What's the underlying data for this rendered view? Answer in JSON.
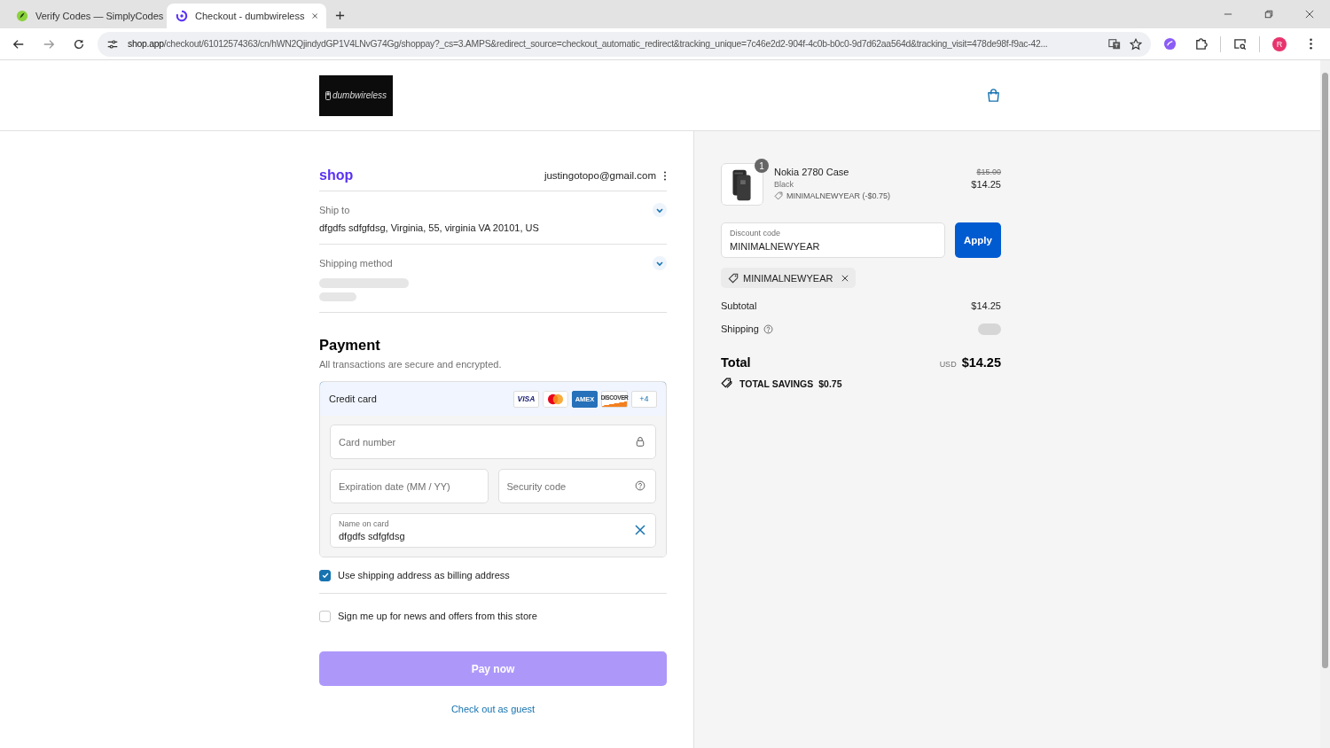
{
  "browser": {
    "tabs": [
      {
        "title": "Verify Codes — SimplyCodes",
        "selected": false
      },
      {
        "title": "Checkout - dumbwireless",
        "selected": true
      }
    ],
    "url_host": "shop.app",
    "url_path": "/checkout/61012574363/cn/hWN2QjindydGP1V4LNvG74Gg/shoppay?_cs=3.AMPS&redirect_source=checkout_automatic_redirect&tracking_unique=7c46e2d2-904f-4c0b-b0c0-9d7d62aa564d&tracking_visit=478de98f-f9ac-42...",
    "profile_initial": "R"
  },
  "header": {
    "logo": "dumbwireless"
  },
  "account": {
    "brand": "shop",
    "email": "justingotopo@gmail.com"
  },
  "sections": [
    {
      "label": "Ship to",
      "value": "dfgdfs sdfgfdsg, Virginia, 55, virginia VA 20101, US",
      "expanded": false
    },
    {
      "label": "Shipping method",
      "expanded": false,
      "loading": true
    }
  ],
  "payment": {
    "title": "Payment",
    "subtitle": "All transactions are secure and encrypted.",
    "method": {
      "label": "Credit card",
      "selected": true,
      "brands": [
        {
          "kind": "visa",
          "label": "VISA"
        },
        {
          "kind": "mastercard"
        },
        {
          "kind": "amex",
          "label": "AMEX"
        },
        {
          "kind": "discover",
          "label": "DISCOVER"
        },
        {
          "kind": "more",
          "label": "+4"
        }
      ]
    },
    "card_number": {
      "placeholder": "Card number"
    },
    "expiry": {
      "placeholder": "Expiration date (MM / YY)"
    },
    "security": {
      "placeholder": "Security code"
    },
    "name": {
      "label": "Name on card",
      "value": "dfgdfs sdfgfdsg"
    }
  },
  "options": [
    {
      "label": "Use shipping address as billing address",
      "checked": true
    },
    {
      "label": "Sign me up for news and offers from this store",
      "checked": false
    }
  ],
  "pay_button": {
    "label": "Pay now",
    "disabled": true
  },
  "guest_link": "Check out as guest",
  "order": {
    "item": {
      "quantity": "1",
      "name": "Nokia 2780 Case",
      "variant": "Black",
      "discount": "MINIMALNEWYEAR (-$0.75)",
      "original_price": "$15.00",
      "price": "$14.25"
    },
    "discount_field": {
      "label": "Discount code",
      "value": "MINIMALNEWYEAR"
    },
    "apply_button": "Apply",
    "applied_code": "MINIMALNEWYEAR",
    "subtotal": {
      "label": "Subtotal",
      "value": "$14.25"
    },
    "shipping": {
      "label": "Shipping",
      "loading": true
    },
    "total": {
      "label": "Total",
      "currency": "USD",
      "value": "$14.25"
    },
    "savings": {
      "label": "TOTAL SAVINGS",
      "value": "$0.75"
    }
  }
}
